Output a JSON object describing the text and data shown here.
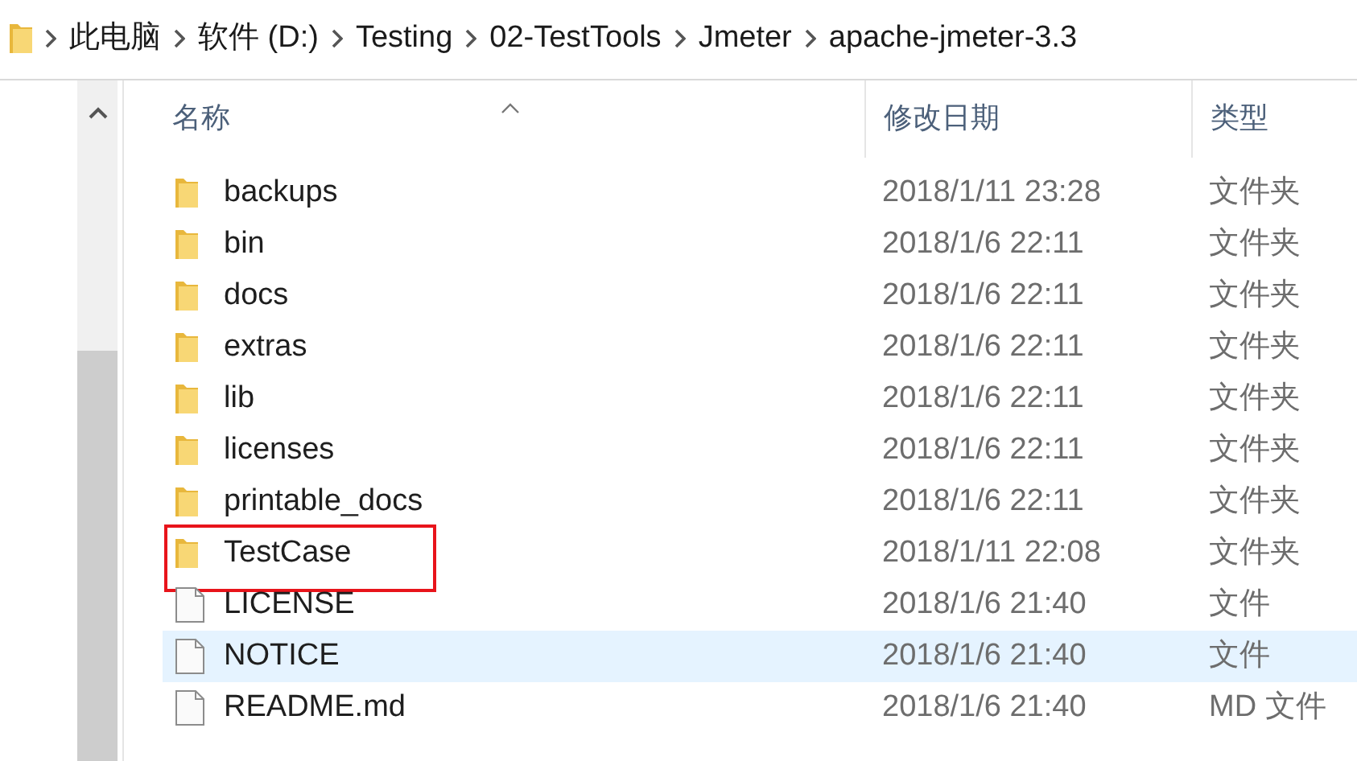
{
  "breadcrumb": [
    "此电脑",
    "软件 (D:)",
    "Testing",
    "02-TestTools",
    "Jmeter",
    "apache-jmeter-3.3"
  ],
  "columns": [
    "名称",
    "修改日期",
    "类型"
  ],
  "rows": [
    {
      "kind": "folder",
      "name": "backups",
      "date": "2018/1/11 23:28",
      "type": "文件夹",
      "hovered": false,
      "annotated": false
    },
    {
      "kind": "folder",
      "name": "bin",
      "date": "2018/1/6 22:11",
      "type": "文件夹",
      "hovered": false,
      "annotated": false
    },
    {
      "kind": "folder",
      "name": "docs",
      "date": "2018/1/6 22:11",
      "type": "文件夹",
      "hovered": false,
      "annotated": false
    },
    {
      "kind": "folder",
      "name": "extras",
      "date": "2018/1/6 22:11",
      "type": "文件夹",
      "hovered": false,
      "annotated": false
    },
    {
      "kind": "folder",
      "name": "lib",
      "date": "2018/1/6 22:11",
      "type": "文件夹",
      "hovered": false,
      "annotated": false
    },
    {
      "kind": "folder",
      "name": "licenses",
      "date": "2018/1/6 22:11",
      "type": "文件夹",
      "hovered": false,
      "annotated": false
    },
    {
      "kind": "folder",
      "name": "printable_docs",
      "date": "2018/1/6 22:11",
      "type": "文件夹",
      "hovered": false,
      "annotated": false
    },
    {
      "kind": "folder",
      "name": "TestCase",
      "date": "2018/1/11 22:08",
      "type": "文件夹",
      "hovered": false,
      "annotated": true
    },
    {
      "kind": "file",
      "name": "LICENSE",
      "date": "2018/1/6 21:40",
      "type": "文件",
      "hovered": false,
      "annotated": false
    },
    {
      "kind": "file",
      "name": "NOTICE",
      "date": "2018/1/6 21:40",
      "type": "文件",
      "hovered": true,
      "annotated": false
    },
    {
      "kind": "file",
      "name": "README.md",
      "date": "2018/1/6 21:40",
      "type": "MD 文件",
      "hovered": false,
      "annotated": false
    }
  ]
}
